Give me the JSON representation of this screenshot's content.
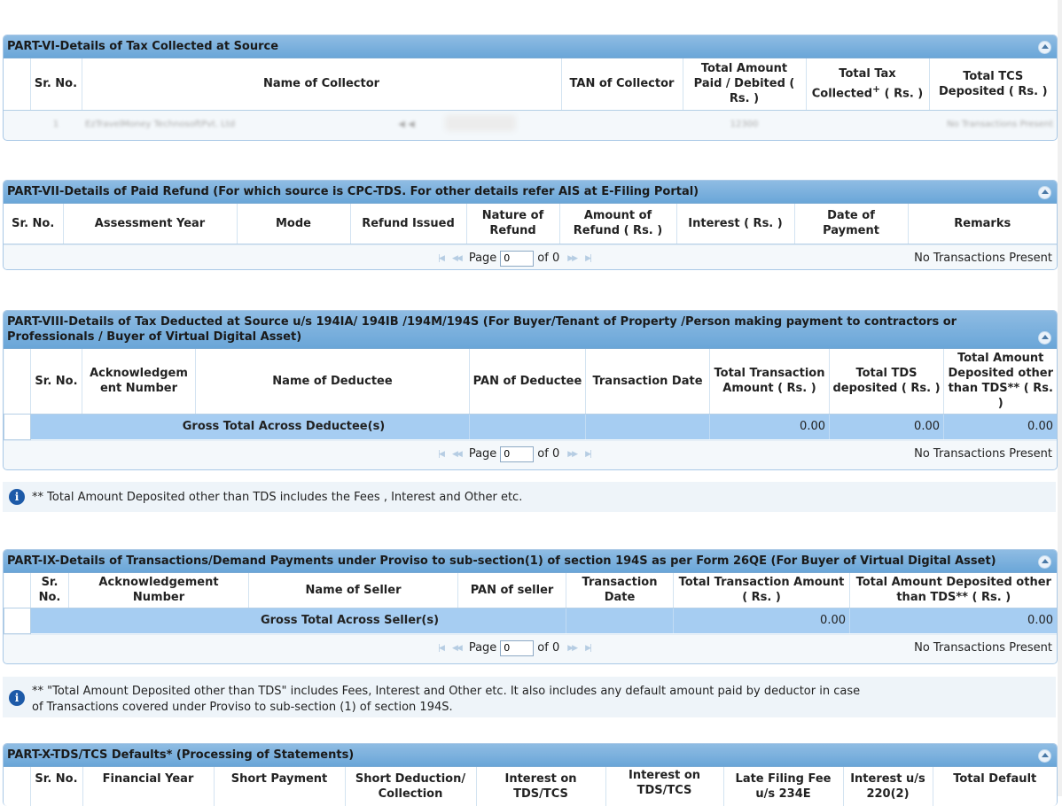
{
  "part6": {
    "title": "PART-VI-Details of Tax Collected at Source",
    "cols": [
      "Sr. No.",
      "Name of Collector",
      "TAN of Collector",
      "Total Amount Paid / Debited ( Rs. )",
      "Total Tax Collected",
      "+",
      " ( Rs. )",
      "Total TCS Deposited ( Rs. )"
    ],
    "row": {
      "sr": "1",
      "name": "EzTravelMoney TechnosoftPvt. Ltd",
      "amount": "12300",
      "norec": "No Transactions Present"
    }
  },
  "part7": {
    "title": "PART-VII-Details of Paid Refund (For which source is CPC-TDS. For other details refer AIS at E-Filing Portal)",
    "cols": [
      "Sr. No.",
      "Assessment Year",
      "Mode",
      "Refund Issued",
      "Nature of Refund",
      "Amount of Refund ( Rs. )",
      "Interest ( Rs. )",
      "Date of Payment",
      "Remarks"
    ],
    "pager": {
      "page_label": "Page",
      "page_value": "0",
      "of_label": "of 0",
      "norec": "No Transactions Present"
    }
  },
  "part8": {
    "title": "PART-VIII-Details of Tax Deducted at Source u/s 194IA/ 194IB /194M/194S (For Buyer/Tenant of Property /Person making payment to contractors or Professionals / Buyer of Virtual Digital Asset)",
    "cols": [
      "Sr. No.",
      "Acknowledgem ent Number",
      "Name of Deductee",
      "PAN of Deductee",
      "Transaction Date",
      "Total Transaction Amount ( Rs. )",
      "Total TDS deposited ( Rs. )",
      "Total Amount Deposited other than TDS** ( Rs. )"
    ],
    "gross": {
      "label": "Gross Total Across Deductee(s)",
      "v1": "0.00",
      "v2": "0.00",
      "v3": "0.00"
    },
    "pager": {
      "page_label": "Page",
      "page_value": "0",
      "of_label": "of 0",
      "norec": "No Transactions Present"
    }
  },
  "info1": {
    "text": "** Total Amount Deposited other than TDS includes the Fees , Interest and Other etc."
  },
  "part9": {
    "title": "PART-IX-Details of Transactions/Demand Payments under Proviso to sub-section(1) of section 194S as per Form 26QE (For Buyer of Virtual Digital Asset)",
    "cols": [
      "Sr. No.",
      "Acknowledgement Number",
      "Name of Seller",
      "PAN of seller",
      "Transaction Date",
      "Total Transaction Amount ( Rs. )",
      "Total Amount Deposited other than TDS** ( Rs. )"
    ],
    "gross": {
      "label": "Gross Total Across Seller(s)",
      "v1": "0.00",
      "v2": "0.00"
    },
    "pager": {
      "page_label": "Page",
      "page_value": "0",
      "of_label": "of 0",
      "norec": "No Transactions Present"
    }
  },
  "info2": {
    "line1": "** \"Total Amount Deposited other than TDS\" includes Fees, Interest and Other etc. It also includes any default amount paid by deductor in case",
    "line2": "of Transactions covered under Proviso to sub-section (1) of section 194S."
  },
  "part10": {
    "title": "PART-X-TDS/TCS Defaults* (Processing of Statements)",
    "cols": [
      "Sr. No.",
      "Financial Year",
      "Short Payment",
      "Short Deduction/ Collection",
      "Interest on TDS/TCS",
      "Interest on TDS/TCS",
      "Late Filing Fee u/s 234E",
      "Interest u/s 220(2)",
      "Total Default"
    ]
  }
}
